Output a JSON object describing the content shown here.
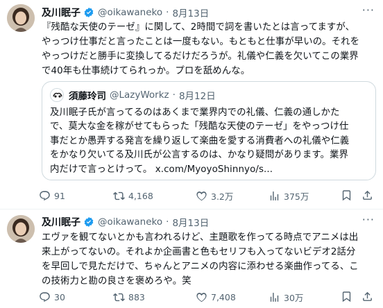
{
  "tweets": [
    {
      "author": {
        "name": "及川眠子",
        "handle": "@oikawaneko",
        "date": "8月13日"
      },
      "text": "『残酷な天使のテーゼ』に関して、2時間で詞を書いたとは言ってますが、\nやっつけ仕事だと言ったことは一度もない。もともと仕事が早いの。それを\nやっつけだと勝手に変換してるだけだろうが。礼儀や仁義を欠いてこの業界\nで40年も仕事続けてられっか。プロを舐めんな。",
      "quote": {
        "author": {
          "name": "須藤玲司",
          "handle": "@LazyWorkz",
          "date": "8月12日"
        },
        "text": "及川眠子氏が言ってるのはあくまで業界内での礼儀、仁義の通しかた\nで、莫大な金を稼がせてもらった「残酷な天使のテーゼ」をやっつけ仕\n事だとか愚弄する発言を繰り返して楽曲を愛する消費者への礼儀や仁義\nをかなり欠いてる及川氏が公言するのは、かなり疑問があります。業界\n内だけで言っとけって。",
        "link": "x.com/MyoyoShinnyo/s..."
      },
      "stats": {
        "replies": "91",
        "retweets": "4,168",
        "likes": "3.2万",
        "views": "375万"
      }
    },
    {
      "author": {
        "name": "及川眠子",
        "handle": "@oikawaneko",
        "date": "8月13日"
      },
      "text": "エヴァを観てないとかも言われるけど、主題歌を作ってる時点でアニメは出\n来上がってないの。それよか企画書と色もセリフも入ってないビデオ2話分\nを早回しで見ただけで、ちゃんとアニメの内容に添わせる楽曲作ってる、こ\nの技術力と勘の良さを褒めろや。笑",
      "stats": {
        "replies": "30",
        "retweets": "883",
        "likes": "7,408",
        "views": "30万"
      }
    }
  ],
  "colors": {
    "text": "#0f1419",
    "muted": "#536471",
    "verified": "#1d9bf0",
    "border": "#cfd9de",
    "divider": "#eff3f4"
  },
  "icons": [
    "reply-icon",
    "retweet-icon",
    "like-icon",
    "views-icon",
    "bookmark-icon",
    "share-icon",
    "verified-badge-icon",
    "more-icon"
  ]
}
